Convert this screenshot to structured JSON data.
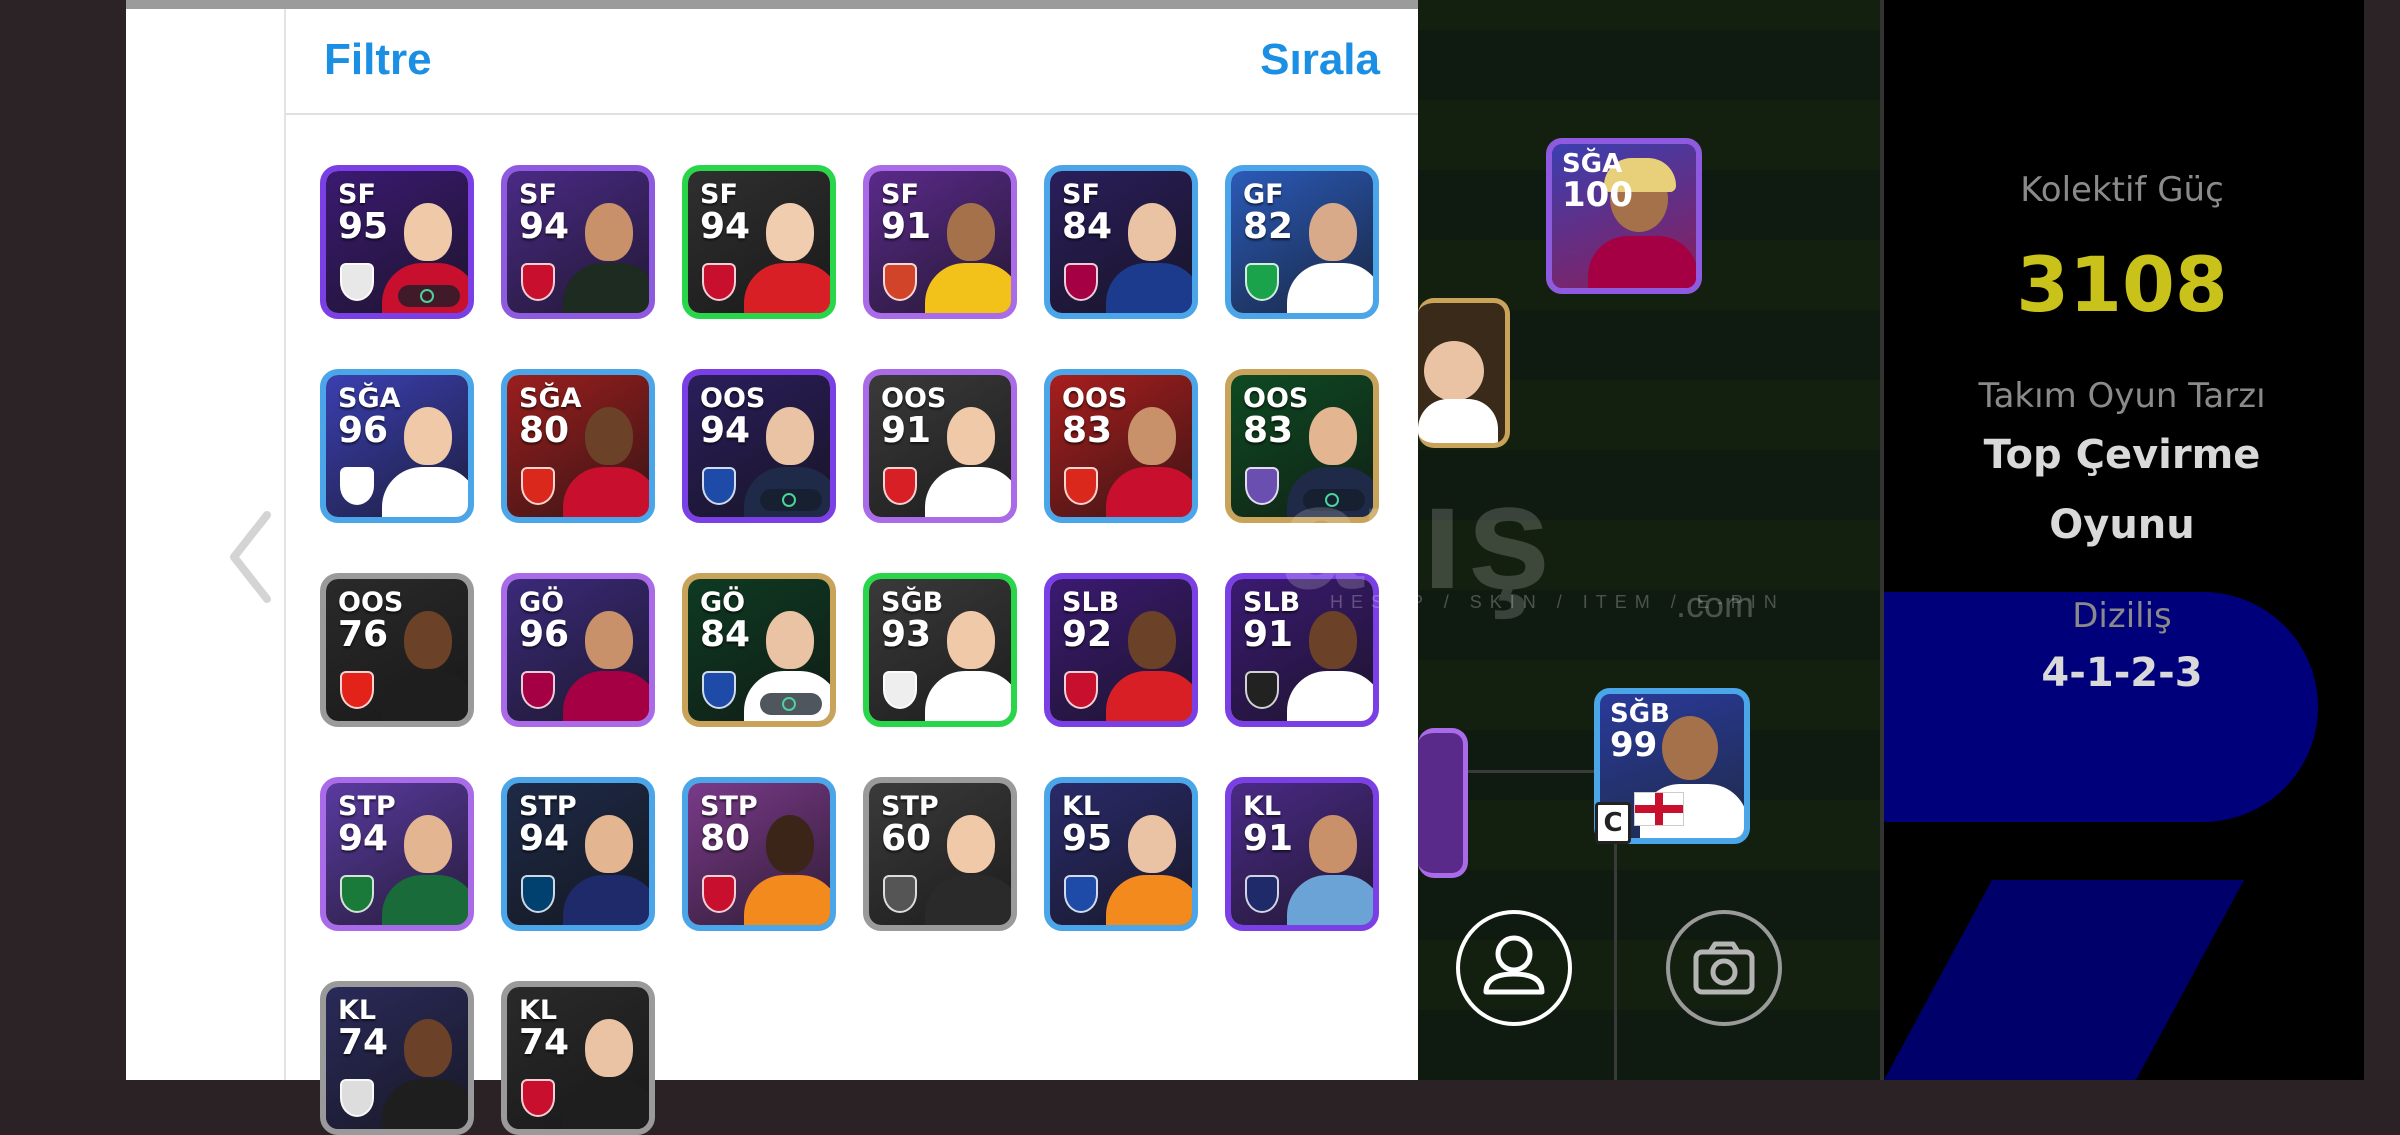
{
  "header": {
    "filter_label": "Filtre",
    "sort_label": "Sırala"
  },
  "colors": {
    "accent": "#1a8fe3",
    "rating_gold": "#c9c21a"
  },
  "cards": [
    {
      "pos": "SF",
      "rating": "95",
      "border": "#7b3fe6",
      "bg": "#3b1a72",
      "skin": "#f0c9a8",
      "kit": "#c8102e",
      "crest": "#e8e8e8",
      "badge": true
    },
    {
      "pos": "SF",
      "rating": "94",
      "border": "#8e5be0",
      "bg": "#4a2a86",
      "skin": "#c8916a",
      "kit": "#1d2b20",
      "crest": "#c8102e",
      "badge": false
    },
    {
      "pos": "SF",
      "rating": "94",
      "border": "#29d64a",
      "bg": "#2f2f2f",
      "skin": "#f1cdb0",
      "kit": "#d81f26",
      "crest": "#c8102e",
      "badge": false
    },
    {
      "pos": "SF",
      "rating": "91",
      "border": "#a96be8",
      "bg": "#5a2a8a",
      "skin": "#a5714b",
      "kit": "#f2c21b",
      "crest": "#d1442a",
      "badge": false
    },
    {
      "pos": "SF",
      "rating": "84",
      "border": "#4aa6e8",
      "bg": "#2a1e5c",
      "skin": "#e9c3a3",
      "kit": "#1d3b8c",
      "crest": "#a50044",
      "badge": false
    },
    {
      "pos": "GF",
      "rating": "82",
      "border": "#4aa6e8",
      "bg": "#2b5ab8",
      "skin": "#d9aa8a",
      "kit": "#ffffff",
      "crest": "#1aa34a",
      "badge": false
    },
    {
      "pos": "SĞA",
      "rating": "96",
      "border": "#4aa6e8",
      "bg": "#3b3fb0",
      "skin": "#f0c9a8",
      "kit": "#ffffff",
      "crest": "#ffffff",
      "badge": false
    },
    {
      "pos": "SĞA",
      "rating": "80",
      "border": "#4aa6e8",
      "bg": "#9b1e1e",
      "skin": "#6b4128",
      "kit": "#c8102e",
      "crest": "#da291c",
      "badge": false
    },
    {
      "pos": "OOS",
      "rating": "94",
      "border": "#7b3fe6",
      "bg": "#2a1e5c",
      "skin": "#e9c3a3",
      "kit": "#1e2a48",
      "crest": "#1e4ba8",
      "badge": true
    },
    {
      "pos": "OOS",
      "rating": "91",
      "border": "#a96be8",
      "bg": "#3a3a3a",
      "skin": "#f0c9a8",
      "kit": "#ffffff",
      "crest": "#d81f26",
      "badge": false
    },
    {
      "pos": "OOS",
      "rating": "83",
      "border": "#4aa6e8",
      "bg": "#a81e1e",
      "skin": "#c8916a",
      "kit": "#c8102e",
      "crest": "#da291c",
      "badge": false
    },
    {
      "pos": "OOS",
      "rating": "83",
      "border": "#c9a35a",
      "bg": "#0e4a22",
      "skin": "#e3b591",
      "kit": "#1e2a48",
      "crest": "#6b4fb0",
      "badge": true
    },
    {
      "pos": "OOS",
      "rating": "76",
      "border": "#9a9a9a",
      "bg": "#2a2a2a",
      "skin": "#6b4128",
      "kit": "#1e1e1e",
      "crest": "#e32219",
      "badge": false
    },
    {
      "pos": "GÖ",
      "rating": "96",
      "border": "#a96be8",
      "bg": "#3b2a7a",
      "skin": "#c8916a",
      "kit": "#a50044",
      "crest": "#a50044",
      "badge": false
    },
    {
      "pos": "GÖ",
      "rating": "84",
      "border": "#c9a35a",
      "bg": "#0e3a22",
      "skin": "#e9c3a3",
      "kit": "#ffffff",
      "crest": "#1e4ba8",
      "badge": true
    },
    {
      "pos": "SĞB",
      "rating": "93",
      "border": "#29d64a",
      "bg": "#3a3a3a",
      "skin": "#f0c9a8",
      "kit": "#ffffff",
      "crest": "#eeeeee",
      "badge": false
    },
    {
      "pos": "SLB",
      "rating": "92",
      "border": "#7b3fe6",
      "bg": "#3b1a72",
      "skin": "#6b4128",
      "kit": "#d81f26",
      "crest": "#c8102e",
      "badge": false
    },
    {
      "pos": "SLB",
      "rating": "91",
      "border": "#7b3fe6",
      "bg": "#3b1a72",
      "skin": "#6b4128",
      "kit": "#ffffff",
      "crest": "#222222",
      "badge": false
    },
    {
      "pos": "STP",
      "rating": "94",
      "border": "#a96be8",
      "bg": "#5a3aa0",
      "skin": "#e3b591",
      "kit": "#1a6b3a",
      "crest": "#1a7a3a",
      "badge": false
    },
    {
      "pos": "STP",
      "rating": "94",
      "border": "#4aa6e8",
      "bg": "#1e2a48",
      "skin": "#e3b591",
      "kit": "#1e2a6a",
      "crest": "#004170",
      "badge": false
    },
    {
      "pos": "STP",
      "rating": "80",
      "border": "#4aa6e8",
      "bg": "#7a3a8a",
      "skin": "#3b2418",
      "kit": "#f28a1e",
      "crest": "#c8102e",
      "badge": false
    },
    {
      "pos": "STP",
      "rating": "60",
      "border": "#9a9a9a",
      "bg": "#3a3a3a",
      "skin": "#f0c9a8",
      "kit": "#2a2a2a",
      "crest": "#555555",
      "badge": false
    },
    {
      "pos": "KL",
      "rating": "95",
      "border": "#4aa6e8",
      "bg": "#2a2a6a",
      "skin": "#e9c3a3",
      "kit": "#f28a1e",
      "crest": "#1e4ba8",
      "badge": false
    },
    {
      "pos": "KL",
      "rating": "91",
      "border": "#7b3fe6",
      "bg": "#4a2a86",
      "skin": "#c8916a",
      "kit": "#6ba3d6",
      "crest": "#1e2a6a",
      "badge": false
    },
    {
      "pos": "KL",
      "rating": "74",
      "border": "#9a9a9a",
      "bg": "#2a2a5a",
      "skin": "#6b4128",
      "kit": "#1e1e1e",
      "crest": "#dddddd",
      "badge": false
    },
    {
      "pos": "KL",
      "rating": "74",
      "border": "#9a9a9a",
      "bg": "#2a2a2a",
      "skin": "#e9c3a3",
      "kit": "#1e1e1e",
      "crest": "#c8102e",
      "badge": false
    }
  ],
  "pitch": {
    "card_top": {
      "pos": "SĞA",
      "rating": "100"
    },
    "card_bottom": {
      "pos": "SĞB",
      "rating": "99"
    },
    "captain": "C"
  },
  "panel": {
    "collective_label": "Kolektif Güç",
    "collective_value": "3108",
    "playstyle_label": "Takım Oyun Tarzı",
    "playstyle_line1": "Top Çevirme",
    "playstyle_line2": "Oyunu",
    "formation_label": "Diziliş",
    "formation_value": "4-1-2-3"
  },
  "watermark": {
    "main": "atış",
    "sub": "HESAP / SKIN / ITEM / E-PIN",
    "com": ".com"
  }
}
